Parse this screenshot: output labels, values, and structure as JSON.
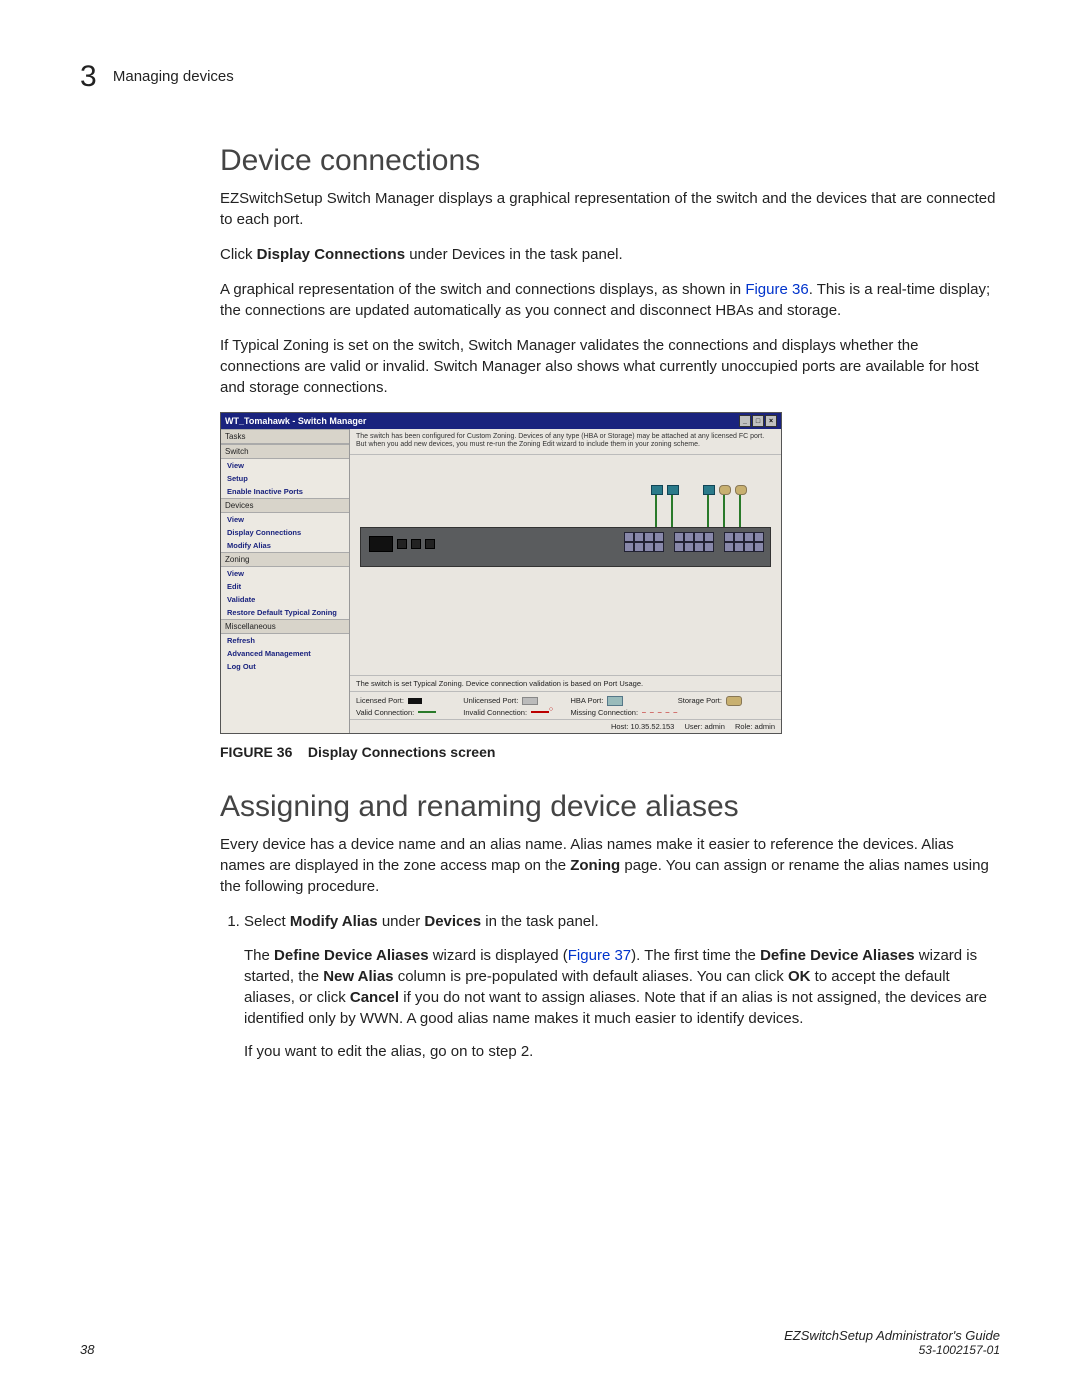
{
  "header": {
    "chapter_number": "3",
    "chapter_title": "Managing devices"
  },
  "section1": {
    "title": "Device connections",
    "p1": "EZSwitchSetup Switch Manager displays a graphical representation of the switch and the devices that are connected to each port.",
    "p2_pre": "Click ",
    "p2_bold": "Display Connections",
    "p2_post": " under Devices in the task panel.",
    "p3_pre": "A graphical representation of the switch and connections displays, as shown in ",
    "p3_link": "Figure 36",
    "p3_post": ". This is a real-time display; the connections are updated automatically as you connect and disconnect HBAs and storage.",
    "p4": "If Typical Zoning is set on the switch, Switch Manager validates the connections and displays whether the connections are valid or invalid. Switch Manager also shows what currently unoccupied ports are available for host and storage connections."
  },
  "figure": {
    "window_title": "WT_Tomahawk - Switch Manager",
    "sidebar": {
      "tasks_head": "Tasks",
      "groups": [
        {
          "head": "Switch",
          "links": [
            "View",
            "Setup",
            "Enable Inactive Ports"
          ]
        },
        {
          "head": "Devices",
          "links": [
            "View",
            "Display Connections",
            "Modify Alias"
          ]
        },
        {
          "head": "Zoning",
          "links": [
            "View",
            "Edit",
            "Validate",
            "Restore Default Typical Zoning"
          ]
        },
        {
          "head": "Miscellaneous",
          "links": [
            "Refresh",
            "Advanced Management",
            "Log Out"
          ]
        }
      ]
    },
    "top_msg": "The switch has been configured for Custom Zoning. Devices of any type (HBA or Storage) may be attached at any licensed FC port. But when you add new devices, you must re-run the Zoning Edit wizard to include them in your zoning scheme.",
    "status_msg": "The switch is set Typical Zoning. Device connection validation is based on Port Usage.",
    "legend": {
      "licensed": "Licensed Port:",
      "unlicensed": "Unlicensed Port:",
      "hba": "HBA Port:",
      "storage": "Storage Port:",
      "valid": "Valid Connection:",
      "invalid": "Invalid Connection:",
      "missing": "Missing Connection:",
      "missing_sw": "– – – – –"
    },
    "footer": {
      "host": "Host: 10.35.52.153",
      "user": "User: admin",
      "role": "Role: admin"
    },
    "caption_label": "FIGURE 36",
    "caption_text": "Display Connections screen"
  },
  "section2": {
    "title": "Assigning and renaming device aliases",
    "intro_pre": "Every device has a device name and an alias name. Alias names make it easier to reference the devices. Alias names are displayed in the zone access map on the ",
    "intro_bold": "Zoning",
    "intro_post": " page. You can assign or rename the alias names using the following procedure.",
    "step1_pre": "Select ",
    "step1_b1": "Modify Alias",
    "step1_mid": " under ",
    "step1_b2": "Devices",
    "step1_post": " in the task panel.",
    "step1_para_a": "The ",
    "step1_para_b1": "Define Device Aliases",
    "step1_para_b": " wizard is displayed (",
    "step1_para_link": "Figure 37",
    "step1_para_c": "). The first time the ",
    "step1_para_b2": "Define Device Aliases",
    "step1_para_d": " wizard is started, the ",
    "step1_para_b3": "New Alias",
    "step1_para_e": " column is pre-populated with default aliases. You can click ",
    "step1_para_b4": "OK",
    "step1_para_f": " to accept the default aliases, or click ",
    "step1_para_b5": "Cancel",
    "step1_para_g": " if you do not want to assign aliases. Note that if an alias is not assigned, the devices are identified only by WWN. A good alias name makes it much easier to identify devices.",
    "step1_para2": "If you want to edit the alias, go on to step 2."
  },
  "footer": {
    "page_number": "38",
    "doc_title": "EZSwitchSetup Administrator's Guide",
    "doc_number": "53-1002157-01"
  }
}
